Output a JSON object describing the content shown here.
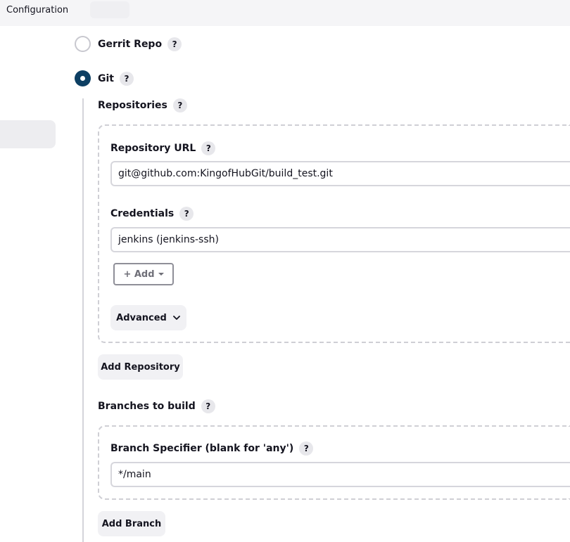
{
  "header": {
    "title": "Configuration"
  },
  "scm": {
    "gerrit": {
      "label": "Gerrit Repo",
      "help": "?"
    },
    "git": {
      "label": "Git",
      "help": "?"
    }
  },
  "repositories": {
    "label": "Repositories",
    "help": "?",
    "url": {
      "label": "Repository URL",
      "help": "?",
      "value": "git@github.com:KingofHubGit/build_test.git"
    },
    "credentials": {
      "label": "Credentials",
      "help": "?",
      "value": "jenkins (jenkins-ssh)"
    },
    "add_label": "+ Add",
    "advanced_label": "Advanced",
    "add_repository_label": "Add Repository"
  },
  "branches": {
    "label": "Branches to build",
    "help": "?",
    "specifier": {
      "label": "Branch Specifier (blank for 'any')",
      "help": "?",
      "value": "*/main"
    },
    "add_branch_label": "Add Branch"
  },
  "colors": {
    "radio_checked": "#0d3f63",
    "help_bg": "#e7e7eb",
    "button_bg": "#f1f1f4"
  }
}
